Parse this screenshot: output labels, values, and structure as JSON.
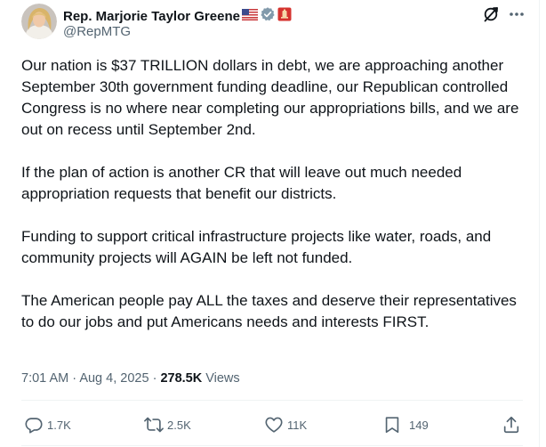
{
  "author": {
    "name": "Rep. Marjorie Taylor Greene",
    "handle": "@RepMTG"
  },
  "icons": {
    "flag": "us-flag-icon",
    "verified": "verified-badge-icon",
    "affiliation": "government-affiliation-icon",
    "grok": "grok-icon",
    "more": "more-options-icon"
  },
  "colors": {
    "verified": "#829aab",
    "affiliation_bg": "#d5322e",
    "muted": "#536471"
  },
  "tweet": {
    "paragraphs": [
      "Our nation is $37 TRILLION dollars in debt, we are approaching another September 30th government funding deadline, our Republican controlled Congress is no where near completing our appropriations bills, and we are out on recess until September 2nd.",
      "If the plan of action is another CR that will leave out much needed appropriation requests that benefit our districts.",
      "Funding to support critical infrastructure projects like water, roads, and community projects will AGAIN be left not funded.",
      "The American people pay ALL the taxes and deserve their representatives to do our jobs and put Americans needs and interests FIRST."
    ]
  },
  "meta": {
    "time": "7:01 AM",
    "separator": "·",
    "date": "Aug 4, 2025",
    "views_count": "278.5K",
    "views_label": "Views"
  },
  "actions": {
    "replies": "1.7K",
    "reposts": "2.5K",
    "likes": "11K",
    "bookmarks": "149"
  }
}
